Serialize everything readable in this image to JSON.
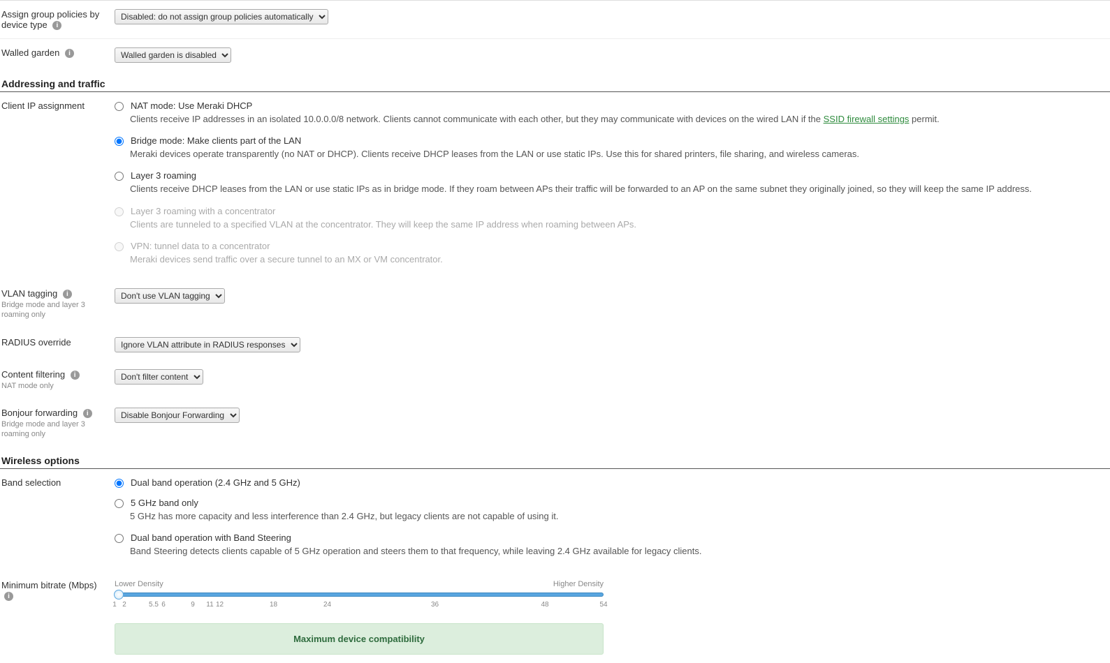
{
  "group_policies": {
    "label": "Assign group policies by device type",
    "selected": "Disabled: do not assign group policies automatically"
  },
  "walled_garden": {
    "label": "Walled garden",
    "selected": "Walled garden is disabled"
  },
  "sections": {
    "addressing": "Addressing and traffic",
    "wireless": "Wireless options"
  },
  "client_ip": {
    "label": "Client IP assignment",
    "options": [
      {
        "title": "NAT mode: Use Meraki DHCP",
        "desc_pre": "Clients receive IP addresses in an isolated 10.0.0.0/8 network. Clients cannot communicate with each other, but they may communicate with devices on the wired LAN if the ",
        "link": "SSID firewall settings",
        "desc_post": " permit.",
        "selected": false,
        "disabled": false
      },
      {
        "title": "Bridge mode: Make clients part of the LAN",
        "desc": "Meraki devices operate transparently (no NAT or DHCP). Clients receive DHCP leases from the LAN or use static IPs. Use this for shared printers, file sharing, and wireless cameras.",
        "selected": true,
        "disabled": false
      },
      {
        "title": "Layer 3 roaming",
        "desc": "Clients receive DHCP leases from the LAN or use static IPs as in bridge mode. If they roam between APs their traffic will be forwarded to an AP on the same subnet they originally joined, so they will keep the same IP address.",
        "selected": false,
        "disabled": false
      },
      {
        "title": "Layer 3 roaming with a concentrator",
        "desc": "Clients are tunneled to a specified VLAN at the concentrator. They will keep the same IP address when roaming between APs.",
        "selected": false,
        "disabled": true
      },
      {
        "title": "VPN: tunnel data to a concentrator",
        "desc": "Meraki devices send traffic over a secure tunnel to an MX or VM concentrator.",
        "selected": false,
        "disabled": true
      }
    ]
  },
  "vlan_tagging": {
    "label": "VLAN tagging",
    "sublabel": "Bridge mode and layer 3 roaming only",
    "selected": "Don't use VLAN tagging"
  },
  "radius_override": {
    "label": "RADIUS override",
    "selected": "Ignore VLAN attribute in RADIUS responses"
  },
  "content_filtering": {
    "label": "Content filtering",
    "sublabel": "NAT mode only",
    "selected": "Don't filter content"
  },
  "bonjour": {
    "label": "Bonjour forwarding",
    "sublabel": "Bridge mode and layer 3 roaming only",
    "selected": "Disable Bonjour Forwarding"
  },
  "band_selection": {
    "label": "Band selection",
    "options": [
      {
        "title": "Dual band operation (2.4 GHz and 5 GHz)",
        "desc": "",
        "selected": true
      },
      {
        "title": "5 GHz band only",
        "desc": "5 GHz has more capacity and less interference than 2.4 GHz, but legacy clients are not capable of using it.",
        "selected": false
      },
      {
        "title": "Dual band operation with Band Steering",
        "desc": "Band Steering detects clients capable of 5 GHz operation and steers them to that frequency, while leaving 2.4 GHz available for legacy clients.",
        "selected": false
      }
    ]
  },
  "bitrate": {
    "label": "Minimum bitrate (Mbps)",
    "lower": "Lower Density",
    "higher": "Higher Density",
    "ticks": [
      {
        "v": "1",
        "p": 0
      },
      {
        "v": "2",
        "p": 2
      },
      {
        "v": "5.5",
        "p": 8
      },
      {
        "v": "6",
        "p": 10
      },
      {
        "v": "9",
        "p": 16
      },
      {
        "v": "11",
        "p": 19.5
      },
      {
        "v": "12",
        "p": 21.5
      },
      {
        "v": "18",
        "p": 32.5
      },
      {
        "v": "24",
        "p": 43.5
      },
      {
        "v": "36",
        "p": 65.5
      },
      {
        "v": "48",
        "p": 88
      },
      {
        "v": "54",
        "p": 100
      }
    ],
    "banner": "Maximum device compatibility"
  }
}
